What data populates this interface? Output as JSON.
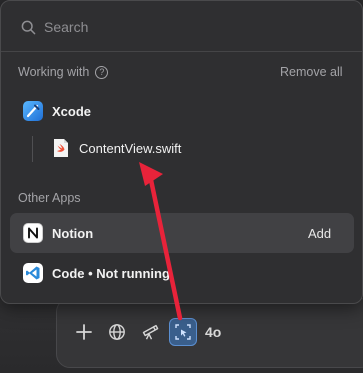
{
  "search": {
    "placeholder": "Search"
  },
  "working_with": {
    "heading": "Working with",
    "remove_all_label": "Remove all",
    "app": {
      "name": "Xcode",
      "icon": "xcode-icon"
    },
    "file": {
      "name": "ContentView.swift",
      "icon": "swift-file-icon"
    }
  },
  "other_apps": {
    "heading": "Other Apps",
    "items": [
      {
        "name": "Notion",
        "action": "Add",
        "icon": "notion-icon"
      },
      {
        "name": "Code • Not running",
        "icon": "vscode-icon"
      }
    ]
  },
  "toolbar": {
    "buttons": [
      "plus-icon",
      "globe-icon",
      "telescope-icon",
      "screen-select-icon"
    ],
    "model_label": "4o"
  },
  "colors": {
    "annotation_arrow": "#e8233a",
    "active_button": "#3a5f8c",
    "popover_bg": "#2f2f31"
  }
}
